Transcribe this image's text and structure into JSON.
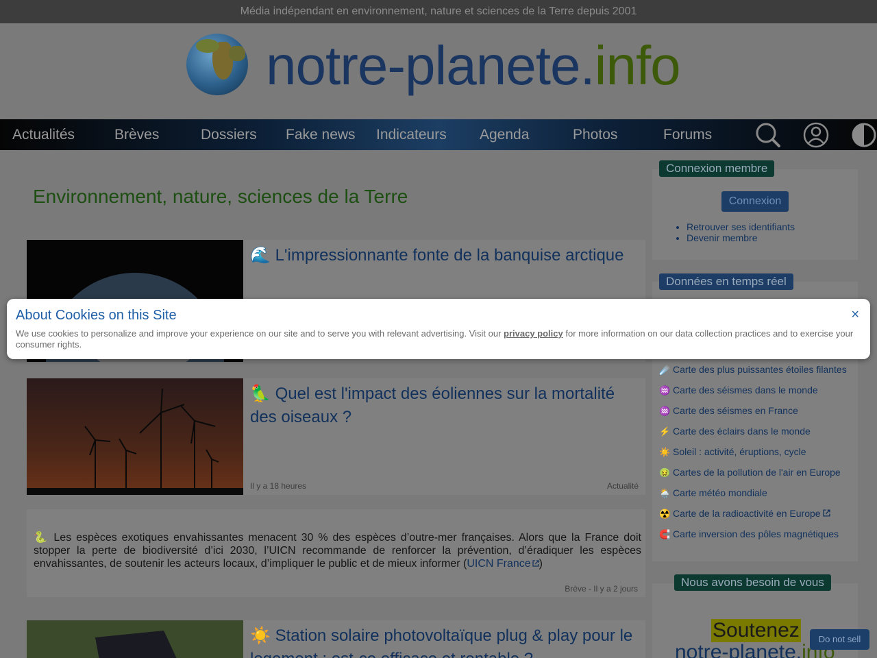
{
  "topbar": {
    "text": "Média indépendant en environnement, nature et sciences de la Terre depuis 2001"
  },
  "logo": {
    "name": "notre-planete.",
    "suffix": "info"
  },
  "nav": {
    "items": [
      "Actualités",
      "Brèves",
      "Dossiers",
      "Fake news",
      "Indicateurs",
      "Agenda",
      "Photos",
      "Forums"
    ],
    "icons": [
      "search-icon",
      "user-icon",
      "contrast-icon"
    ]
  },
  "main": {
    "title": "Environnement, nature, sciences de la Terre",
    "articles": [
      {
        "emoji": "🌊",
        "title": "L'impressionnante fonte de la banquise arctique"
      },
      {
        "emoji": "🦜",
        "title": "Quel est l'impact des éoliennes sur la mortalité des oiseaux ?",
        "time": "Il y a 18 heures",
        "category": "Actualité"
      },
      {
        "emoji": "☀️",
        "title": "Station solaire photovoltaïque plug & play pour le logement : est-ce efficace et rentable ?"
      }
    ],
    "breve": {
      "emoji": "🐍",
      "text": "Les espèces exotiques envahissantes menacent 30 % des espèces d’outre-mer françaises. Alors que la France doit stopper la perte de biodiversité d’ici 2030, l’UICN recommande de renforcer la prévention, d’éradiquer les espèces envahissantes, de soutenir les acteurs locaux, d’impliquer le public et de mieux informer (",
      "link": "UICN France",
      "close": ")",
      "meta": "Brève - Il y a 2 jours"
    }
  },
  "sidebar": {
    "member": {
      "title": "Connexion membre",
      "button": "Connexion",
      "links": [
        "Retrouver ses identifiants",
        "Devenir membre"
      ]
    },
    "realtime": {
      "title": "Données en temps réel",
      "items": [
        {
          "icon": "☄️",
          "label": "Carte des plus puissantes étoiles filantes"
        },
        {
          "icon": "♒",
          "label": "Carte des séismes dans le monde"
        },
        {
          "icon": "♒",
          "label": "Carte des séismes en France"
        },
        {
          "icon": "⚡",
          "label": "Carte des éclairs dans le monde"
        },
        {
          "icon": "☀️",
          "label": "Soleil : activité, éruptions, cycle"
        },
        {
          "icon": "🤢",
          "label": "Cartes de la pollution de l'air en Europe"
        },
        {
          "icon": "🌦️",
          "label": "Carte météo mondiale"
        },
        {
          "icon": "☢️",
          "label": "Carte de la radioactivité en Europe"
        },
        {
          "icon": "🧲",
          "label": "Carte inversion des pôles magnétiques"
        }
      ]
    },
    "support": {
      "title": "Nous avons besoin de vous",
      "line1": "Soutenez",
      "line2a": "notre-planete.",
      "line2b": "info"
    }
  },
  "cookie": {
    "title": "About Cookies on this Site",
    "close": "×",
    "text_before": "We use cookies to personalize and improve your experience on our site and to serve you with relevant advertising. Visit our ",
    "link": "privacy policy",
    "text_after": " for more information on our data collection practices and to exercise your consumer rights."
  },
  "dns_button": "Do not sell",
  "colors": {
    "brand_blue": "#1f5fa8",
    "brand_green": "#3d5a0a",
    "dim_overlay": "#7a7a7a"
  }
}
